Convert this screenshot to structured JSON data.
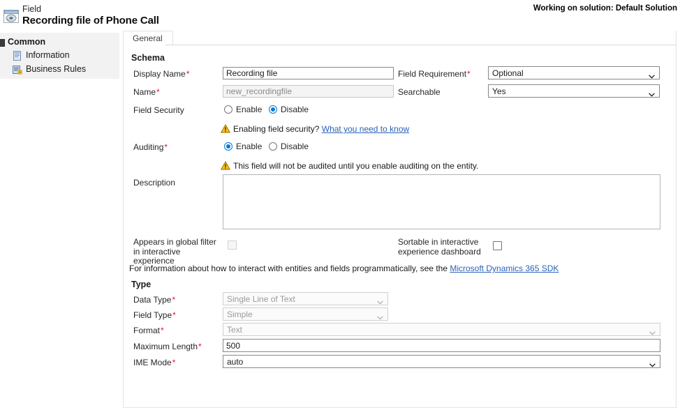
{
  "header": {
    "icon": "form-window-icon",
    "subtitle": "Field",
    "title": "Recording file of Phone Call",
    "solution_text": "Working on solution: Default Solution"
  },
  "sidebar": {
    "group_label": "Common",
    "collapse_icon": "collapse-minus-icon",
    "items": [
      {
        "label": "Information",
        "icon": "information-page-icon"
      },
      {
        "label": "Business Rules",
        "icon": "business-rules-icon"
      }
    ]
  },
  "tabs": [
    {
      "label": "General",
      "selected": true
    }
  ],
  "form": {
    "schema_heading": "Schema",
    "type_heading": "Type",
    "labels": {
      "display_name": "Display Name",
      "name": "Name",
      "field_security": "Field Security",
      "auditing": "Auditing",
      "description": "Description",
      "global_filter": "Appears in global filter in interactive experience",
      "field_requirement": "Field Requirement",
      "searchable": "Searchable",
      "sortable": "Sortable in interactive experience dashboard",
      "data_type": "Data Type",
      "field_type": "Field Type",
      "format": "Format",
      "maximum_length": "Maximum Length",
      "ime_mode": "IME Mode"
    },
    "values": {
      "display_name": "Recording file",
      "name": "new_recordingfile",
      "description": "",
      "field_requirement": "Optional",
      "searchable": "Yes",
      "data_type": "Single Line of Text",
      "field_type": "Simple",
      "format": "Text",
      "maximum_length": "500",
      "ime_mode": "auto"
    },
    "radio_options": {
      "enable": "Enable",
      "disable": "Disable"
    },
    "field_security_selected": "Disable",
    "auditing_selected": "Enable",
    "warnings": {
      "field_security": "Enabling field security?",
      "field_security_link": "What you need to know",
      "auditing": "This field will not be audited until you enable auditing on the entity."
    },
    "sdk_line": {
      "text": "For information about how to interact with entities and fields programmatically, see the ",
      "link": "Microsoft Dynamics 365 SDK"
    },
    "checkboxes": {
      "global_filter_checked": false,
      "sortable_checked": false
    }
  },
  "colors": {
    "accent": "#0078d4",
    "required": "#e81123",
    "link": "#2a62b8",
    "warning": "#ffc20e",
    "sidebar_bg": "#f2f2f2"
  }
}
